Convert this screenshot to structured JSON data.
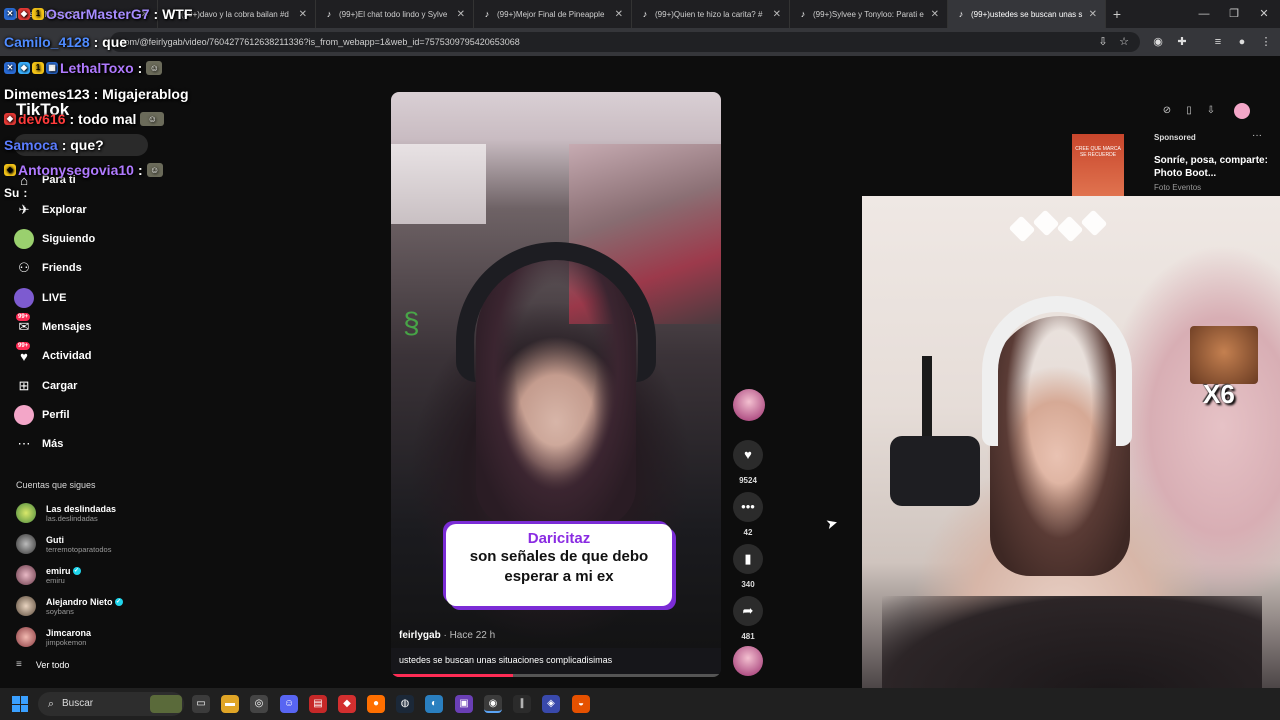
{
  "browser": {
    "tabs": [
      {
        "title": "OscarMasterG7",
        "active": false
      },
      {
        "title": "(99+)davo y la cobra bailan #d",
        "active": false
      },
      {
        "title": "(99+)El chat todo lindo y Sylve",
        "active": false
      },
      {
        "title": "(99+)Mejor Final de Pineapple",
        "active": false
      },
      {
        "title": "(99+)Quien te hizo la carita? #",
        "active": false
      },
      {
        "title": "(99+)Sylvee y Tonyloo: Parati e",
        "active": false
      },
      {
        "title": "(99+)ustedes se buscan unas s",
        "active": true
      }
    ],
    "new_tab": "+",
    "url": "com/@feirlygab/video/7604277612638211336?is_from_webapp=1&web_id=7575309795420653068"
  },
  "chat": [
    {
      "user": "OscarMasterG7",
      "message": ": WTF",
      "color": "#a78cff"
    },
    {
      "user": "Camilo_4128",
      "message": ": que",
      "color": "#4f8bff"
    },
    {
      "user": "LethalToxo",
      "message": ":",
      "color": "#b07aff"
    },
    {
      "user": "Dimemes123",
      "message": ": Migajerablog",
      "color": "#ffffff"
    },
    {
      "user": "dev616",
      "message": ": todo mal",
      "color": "#ff3b3b"
    },
    {
      "user": "Samoca",
      "message": ": que?",
      "color": "#5b7dff"
    },
    {
      "user": "Antonysegovia10",
      "message": ":",
      "color": "#b07aff"
    },
    {
      "user": "Su",
      "message": ":",
      "color": "#ffffff"
    }
  ],
  "tiktok": {
    "logo": "TikTok",
    "nav": [
      {
        "label": "Para ti",
        "icon": "home-icon"
      },
      {
        "label": "Explorar",
        "icon": "compass-icon"
      },
      {
        "label": "Siguiendo",
        "icon": "following-icon"
      },
      {
        "label": "Friends",
        "icon": "friends-icon"
      },
      {
        "label": "LIVE",
        "icon": "live-icon"
      },
      {
        "label": "Mensajes",
        "icon": "messages-icon",
        "badge": "99+"
      },
      {
        "label": "Actividad",
        "icon": "activity-icon",
        "badge": "99+"
      },
      {
        "label": "Cargar",
        "icon": "upload-icon"
      },
      {
        "label": "Perfil",
        "icon": "profile-icon"
      },
      {
        "label": "Más",
        "icon": "more-icon"
      }
    ],
    "following_title": "Cuentas que sigues",
    "accounts": [
      {
        "name": "Las deslindadas",
        "handle": "las.deslindadas",
        "verified": false
      },
      {
        "name": "Guti",
        "handle": "terremotoparatodos",
        "verified": false
      },
      {
        "name": "emiru",
        "handle": "emiru",
        "verified": true
      },
      {
        "name": "Alejandro Nieto",
        "handle": "soybans",
        "verified": true
      },
      {
        "name": "Jimcarona",
        "handle": "jimpokemon",
        "verified": false
      }
    ],
    "see_all": "Ver todo",
    "video": {
      "caption_title": "Daricitaz",
      "caption_text": "son señales de que debo esperar a mi ex",
      "author": "feirlygab",
      "time": "· Hace 22 h",
      "description": "ustedes se buscan unas situaciones complicadisimas",
      "progress": 0.37
    },
    "actions": {
      "likes": "9524",
      "comments": "42",
      "saves": "340",
      "shares": "481"
    },
    "ad": {
      "sponsored": "Sponsored",
      "title": "Sonríe, posa, comparte: Photo Boot...",
      "subtitle": "Foto Eventos",
      "thumb_text": "CREE QUE MARCA SE RECUERDE"
    }
  },
  "webcam": {
    "multiplier": "X6"
  },
  "taskbar": {
    "search_placeholder": "Buscar"
  }
}
